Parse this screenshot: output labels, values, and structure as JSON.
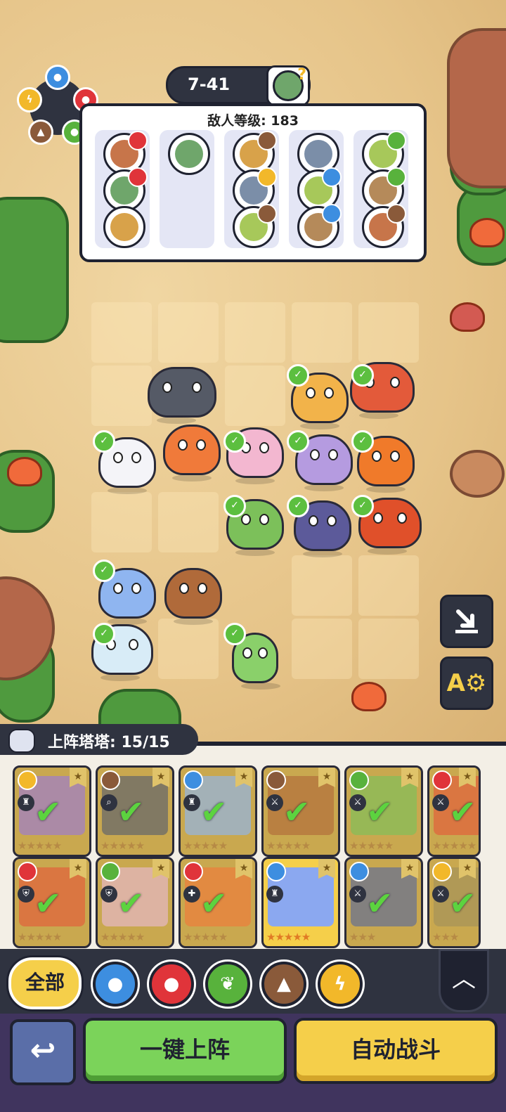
{
  "stage": {
    "label": "7-41",
    "boss_icon": "zombie-question-icon"
  },
  "enemy_panel": {
    "level_text": "敌人等级: 183",
    "columns": [
      {
        "enemies": [
          {
            "icon": "mushroom-enemy",
            "element": "fire"
          },
          {
            "icon": "lava-enemy",
            "element": "fire"
          },
          {
            "icon": "zombie-enemy",
            "element": "none"
          }
        ]
      },
      {
        "enemies": [
          {
            "icon": "zombie-enemy",
            "element": "none"
          }
        ]
      },
      {
        "enemies": [
          {
            "icon": "cowboy-enemy",
            "element": "earth"
          },
          {
            "icon": "plant-enemy",
            "element": "thunder"
          },
          {
            "icon": "hat-enemy",
            "element": "earth"
          }
        ]
      },
      {
        "enemies": [
          {
            "icon": "zombie-enemy",
            "element": "none"
          },
          {
            "icon": "knight-enemy",
            "element": "water"
          },
          {
            "icon": "goggle-zombie-enemy",
            "element": "water"
          }
        ]
      },
      {
        "enemies": [
          {
            "icon": "leaf-enemy",
            "element": "grass"
          },
          {
            "icon": "slime-enemy",
            "element": "grass"
          },
          {
            "icon": "cowboy-enemy",
            "element": "earth"
          }
        ]
      }
    ]
  },
  "roster": {
    "label": "上阵塔塔: 15/15",
    "cards": [
      {
        "element": "thunder",
        "role": "bag",
        "stars": 5,
        "deployed": true,
        "gold": false
      },
      {
        "element": "earth",
        "role": "search",
        "stars": 5,
        "deployed": true,
        "gold": false
      },
      {
        "element": "water",
        "role": "bag",
        "stars": 5,
        "deployed": true,
        "gold": false
      },
      {
        "element": "earth",
        "role": "sword",
        "stars": 5,
        "deployed": true,
        "gold": false
      },
      {
        "element": "grass",
        "role": "sword",
        "stars": 5,
        "deployed": true,
        "gold": false
      },
      {
        "element": "fire",
        "role": "sword",
        "stars": 5,
        "deployed": true,
        "gold": false
      },
      {
        "element": "fire",
        "role": "shield",
        "stars": 5,
        "deployed": true,
        "gold": false
      },
      {
        "element": "grass",
        "role": "shield",
        "stars": 5,
        "deployed": true,
        "gold": false
      },
      {
        "element": "fire",
        "role": "heal",
        "stars": 5,
        "deployed": true,
        "gold": false
      },
      {
        "element": "water",
        "role": "bag",
        "stars": 5,
        "deployed": false,
        "gold": true
      },
      {
        "element": "water",
        "role": "sword",
        "stars": 3,
        "deployed": true,
        "gold": false
      },
      {
        "element": "thunder",
        "role": "sword",
        "stars": 3,
        "deployed": true,
        "gold": false
      }
    ]
  },
  "filters": {
    "all_label": "全部",
    "elements": [
      "water",
      "fire",
      "grass",
      "earth",
      "thunder"
    ]
  },
  "actions": {
    "back_icon": "return-arrow-icon",
    "deploy_label": "一键上阵",
    "auto_label": "自动战斗"
  },
  "colors": {
    "water": "#3d8ee0",
    "fire": "#e0343a",
    "grass": "#58b23c",
    "earth": "#8a5a3a",
    "thunder": "#f2b82a",
    "none": "#8a8a8a"
  }
}
